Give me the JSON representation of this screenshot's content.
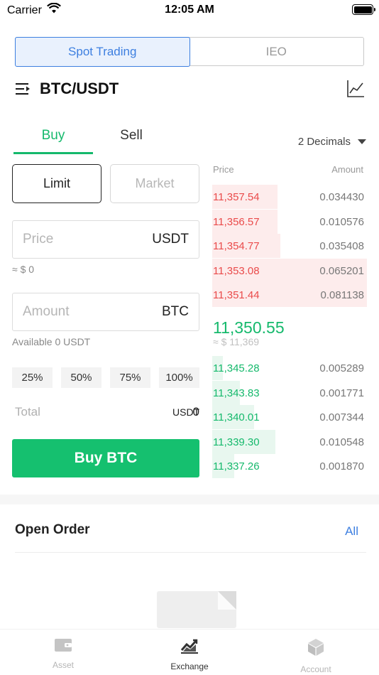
{
  "status_bar": {
    "carrier": "Carrier",
    "time": "12:05 AM"
  },
  "segment": {
    "tabs": [
      "Spot Trading",
      "IEO"
    ],
    "active": "Spot Trading"
  },
  "pair": {
    "title": "BTC/USDT"
  },
  "trade_tabs": {
    "buy": "Buy",
    "sell": "Sell",
    "active": "Buy"
  },
  "decimals": {
    "label": "2 Decimals"
  },
  "order_type": {
    "limit": "Limit",
    "market": "Market",
    "active": "Limit"
  },
  "price_field": {
    "placeholder": "Price",
    "unit": "USDT",
    "approx": "≈ $ 0"
  },
  "amount_field": {
    "placeholder": "Amount",
    "unit": "BTC",
    "available": "Available 0 USDT"
  },
  "percent_buttons": [
    "25%",
    "50%",
    "75%",
    "100%"
  ],
  "total": {
    "label": "Total",
    "value": "0",
    "unit": "USDT"
  },
  "buy_button": {
    "label": "Buy BTC"
  },
  "order_book": {
    "header_price": "Price",
    "header_amount": "Amount",
    "asks": [
      {
        "price": "11,357.54",
        "amount": "0.034430",
        "depth": 0.42
      },
      {
        "price": "11,356.57",
        "amount": "0.010576",
        "depth": 0.42
      },
      {
        "price": "11,354.77",
        "amount": "0.035408",
        "depth": 0.44
      },
      {
        "price": "11,353.08",
        "amount": "0.065201",
        "depth": 1.0
      },
      {
        "price": "11,351.44",
        "amount": "0.081138",
        "depth": 1.0
      }
    ],
    "last_price": "11,350.55",
    "last_fiat": "≈ $ 11,369",
    "bids": [
      {
        "price": "11,345.28",
        "amount": "0.005289",
        "depth": 0.07
      },
      {
        "price": "11,343.83",
        "amount": "0.001771",
        "depth": 0.18
      },
      {
        "price": "11,340.01",
        "amount": "0.007344",
        "depth": 0.27
      },
      {
        "price": "11,339.30",
        "amount": "0.010548",
        "depth": 0.41
      },
      {
        "price": "11,337.26",
        "amount": "0.001870",
        "depth": 0.14
      }
    ]
  },
  "open_order": {
    "title": "Open Order",
    "all_link": "All"
  },
  "tab_bar": {
    "items": [
      {
        "label": "Asset",
        "icon": "wallet-icon"
      },
      {
        "label": "Exchange",
        "icon": "exchange-chart-icon"
      },
      {
        "label": "Account",
        "icon": "cube-icon"
      }
    ],
    "active": "Exchange"
  },
  "colors": {
    "green": "#15b96c",
    "red": "#ea4b4b",
    "blue": "#3d7fe0"
  }
}
